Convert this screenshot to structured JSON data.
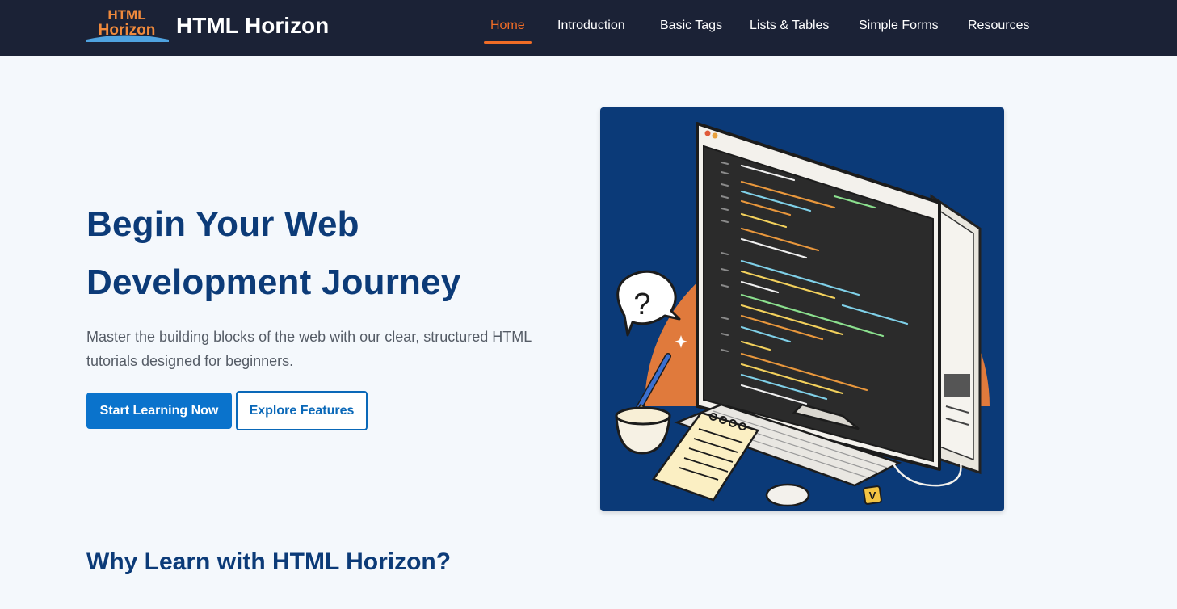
{
  "logo": {
    "line1": "HTML",
    "line2": "Horizon"
  },
  "brand": {
    "name": "HTML Horizon"
  },
  "nav": {
    "items": [
      {
        "label": "Home",
        "active": true
      },
      {
        "label": "Introduction",
        "active": false
      },
      {
        "label": "Basic Tags",
        "active": false
      },
      {
        "label": "Lists & Tables",
        "active": false
      },
      {
        "label": "Simple Forms",
        "active": false
      },
      {
        "label": "Resources",
        "active": false
      }
    ]
  },
  "hero": {
    "title_line1": "Begin Your Web",
    "title_line2": "Development Journey",
    "subtitle": "Master the building blocks of the web with our clear, structured HTML tutorials designed for beginners.",
    "primary_button": "Start Learning Now",
    "secondary_button": "Explore Features",
    "illustration": {
      "icons": [
        "computer-monitor-icon",
        "keyboard-icon",
        "mouse-icon",
        "question-bubble-icon",
        "coffee-cup-icon",
        "pencil-icon",
        "notepad-icon"
      ],
      "bubble_text": "?",
      "tag_text": "V"
    }
  },
  "features": {
    "heading": "Why Learn with HTML Horizon?"
  },
  "colors": {
    "nav_bg": "#1b2236",
    "accent": "#ef6c26",
    "heading": "#0c3b78",
    "primary": "#0a73cc",
    "page_bg": "#f4f8fc",
    "image_bg": "#0b3a78"
  }
}
